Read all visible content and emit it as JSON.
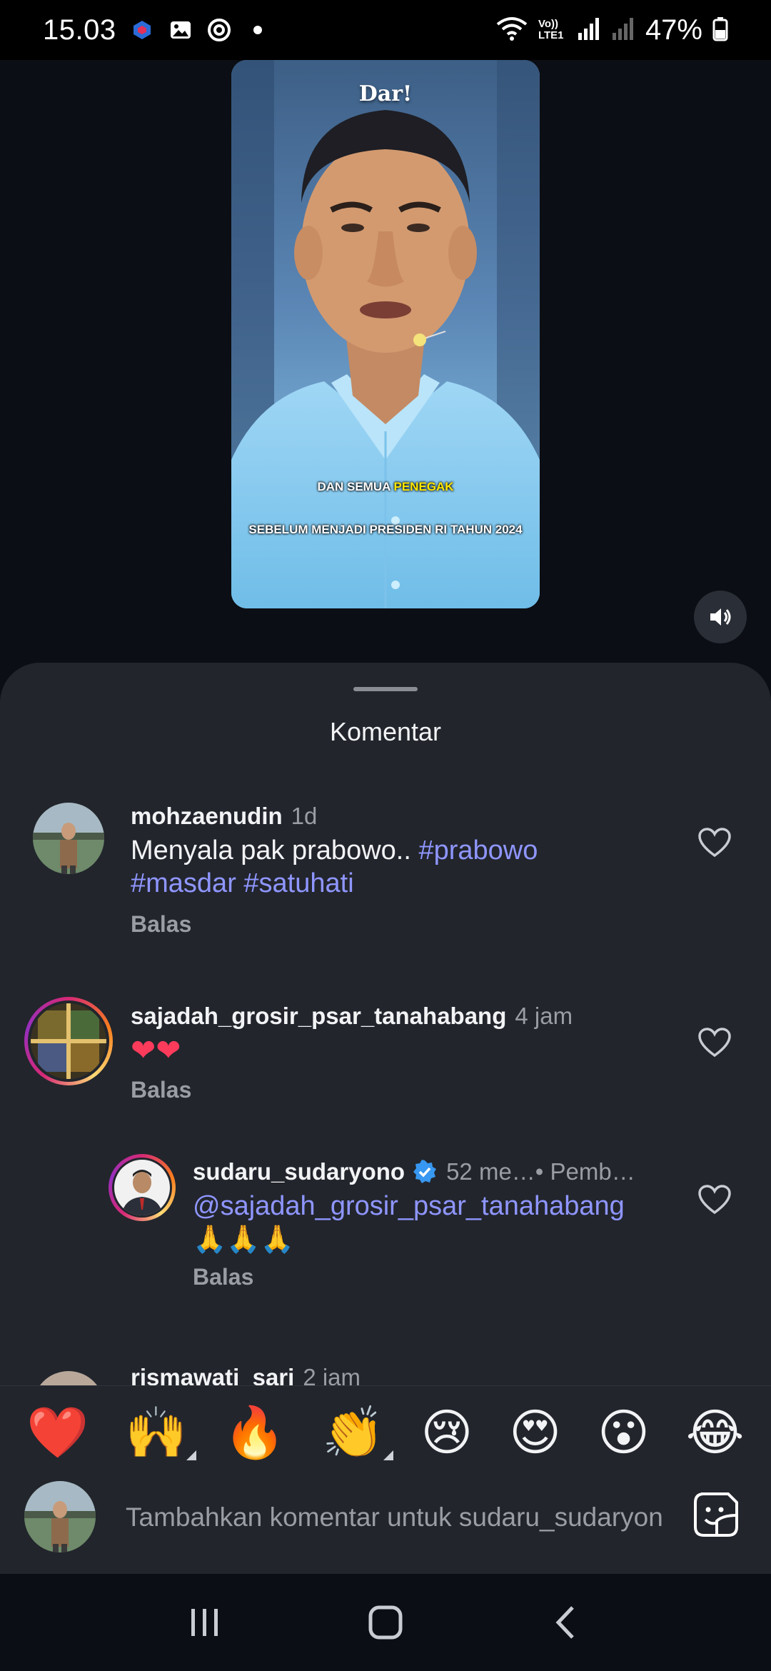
{
  "status_bar": {
    "time": "15.03",
    "network_label": "Vo)) LTE1",
    "battery": "47%"
  },
  "video": {
    "watermark": "Dar!",
    "caption_line1_a": "DAN SEMUA ",
    "caption_line1_b": "PENEGAK",
    "caption_line2": "SEBELUM MENJADI  PRESIDEN RI TAHUN 2024",
    "mute_icon": "speaker-icon"
  },
  "comments_sheet": {
    "title": "Komentar",
    "comments": [
      {
        "username": "mohzaenudin",
        "time": "1d",
        "text_plain": "Menyala pak prabowo.. ",
        "tags": [
          "#prabowo",
          "#masdar",
          "#satuhati"
        ],
        "reply": "Balas"
      },
      {
        "username": "sajadah_grosir_psar_tanahabang",
        "time": "4 jam",
        "text": "❤❤",
        "reply": "Balas"
      },
      {
        "username": "sudaru_sudaryono",
        "time": "52 me…",
        "extra": " • Pemb…",
        "mention": "@sajadah_grosir_psar_tanahabang",
        "text": "🙏🙏🙏",
        "reply": "Balas"
      },
      {
        "username": "rismawati_sari",
        "time": "2 jam"
      }
    ]
  },
  "emoji_bar": [
    "❤️",
    "🙌",
    "🔥",
    "👏",
    "😢",
    "😍",
    "😮",
    "😂"
  ],
  "input": {
    "placeholder": "Tambahkan komentar untuk sudaru_sudaryono..."
  },
  "colors": {
    "sheet_bg": "#22252c",
    "tag": "#8f96ff",
    "verified": "#3897f0"
  }
}
